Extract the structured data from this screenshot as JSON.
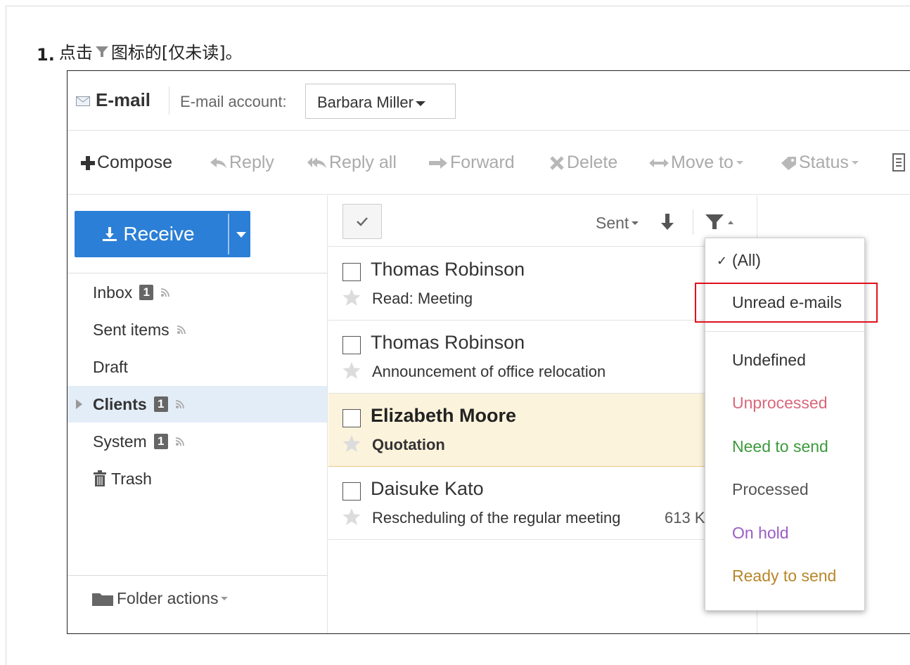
{
  "instruction": {
    "step_number": "1.",
    "text_before": "点击",
    "text_after": "图标的[仅未读]。",
    "icon": "filter-icon"
  },
  "header": {
    "app_title": "E-mail",
    "account_label": "E-mail account:",
    "account_value": "Barbara Miller"
  },
  "toolbar": {
    "compose": "Compose",
    "reply": "Reply",
    "reply_all": "Reply all",
    "forward": "Forward",
    "delete": "Delete",
    "move_to": "Move to",
    "status": "Status"
  },
  "sidebar": {
    "receive": "Receive",
    "folders": [
      {
        "label": "Inbox",
        "badge": "1",
        "rss": true
      },
      {
        "label": "Sent items",
        "badge": "",
        "rss": true
      },
      {
        "label": "Draft",
        "badge": "",
        "rss": false
      },
      {
        "label": "Clients",
        "badge": "1",
        "rss": true,
        "selected": true
      },
      {
        "label": "System",
        "badge": "1",
        "rss": true
      },
      {
        "label": "Trash",
        "badge": "",
        "rss": false
      }
    ],
    "folder_actions": "Folder actions"
  },
  "list": {
    "sort_label": "Sent",
    "mails": [
      {
        "sender": "Thomas Robinson",
        "subject": "Read: Meeting",
        "size": "",
        "unread": false
      },
      {
        "sender": "Thomas Robinson",
        "subject": "Announcement of office relocation",
        "size": "",
        "unread": false
      },
      {
        "sender": "Elizabeth Moore",
        "subject": "Quotation",
        "size": "",
        "unread": true
      },
      {
        "sender": "Daisuke Kato",
        "subject": "Rescheduling of the regular meeting",
        "size": "613 K",
        "unread": false
      }
    ]
  },
  "filter_menu": {
    "checked_mark": "✓",
    "items": [
      {
        "label": "(All)",
        "color": "#333333",
        "checked": true
      },
      {
        "label": "Unread e-mails",
        "color": "#333333",
        "highlighted": true
      },
      {
        "label": "Undefined",
        "color": "#333333"
      },
      {
        "label": "Unprocessed",
        "color": "#d9677a"
      },
      {
        "label": "Need to send",
        "color": "#3c9a3c"
      },
      {
        "label": "Processed",
        "color": "#555555"
      },
      {
        "label": "On hold",
        "color": "#9b5cc6"
      },
      {
        "label": "Ready to send",
        "color": "#b8862a"
      }
    ]
  },
  "colors": {
    "accent": "#2b7fd6",
    "selected_folder_bg": "#e3edf8",
    "highlight_row_bg": "#fcf3dc",
    "annotation_red": "#e0101a"
  }
}
